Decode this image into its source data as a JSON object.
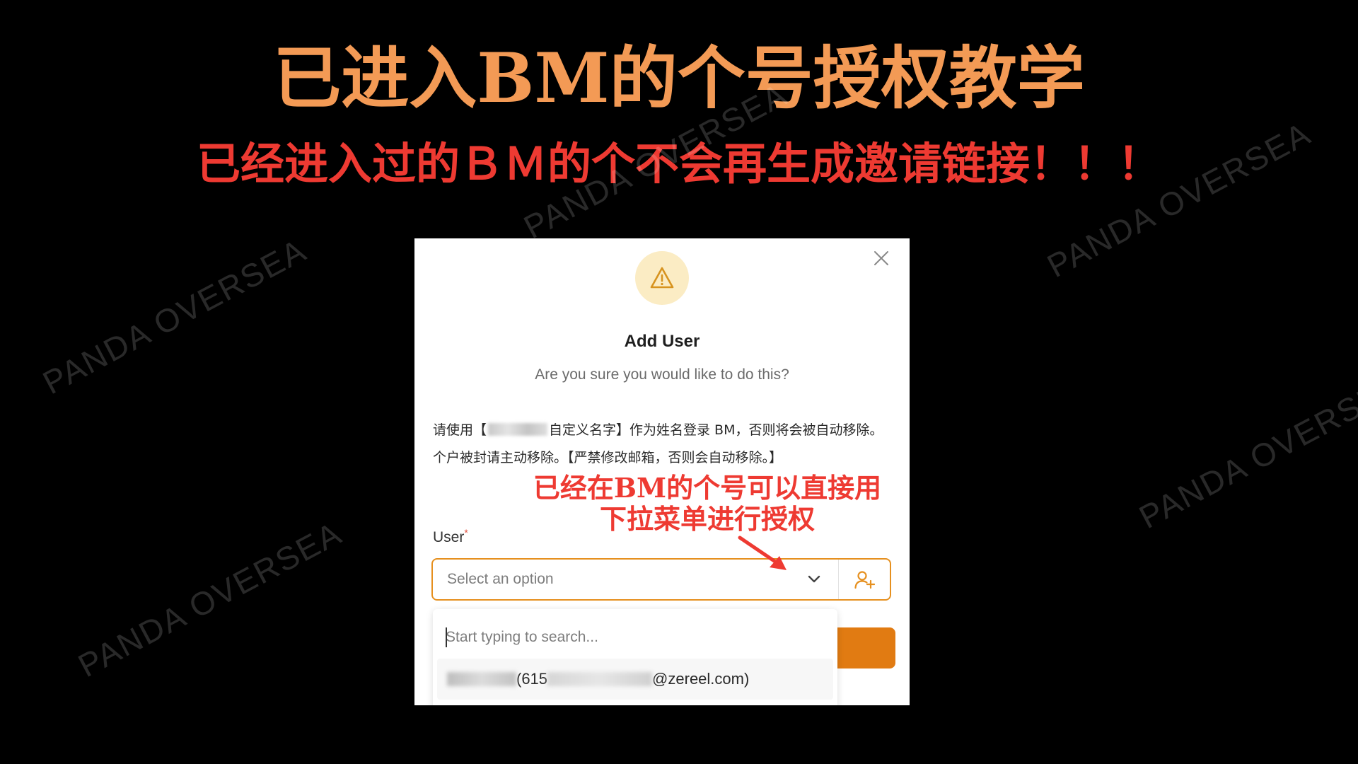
{
  "headline": "已进入BM的个号授权教学",
  "subheadline": "已经进入过的ＢＭ的个不会再生成邀请链接！！！",
  "watermark_text": "PANDA OVERSEA",
  "modal": {
    "title": "Add User",
    "subtitle": "Are you sure you would like to do this?",
    "notice": {
      "part1": "请使用【",
      "part2": "自定义名字】作为姓名登录 BM，否则将会被自动移除。个户被封请主动移除。【严禁修改邮箱，否则会自动移除。】"
    },
    "user_field": {
      "label": "User",
      "required_mark": "*",
      "placeholder": "Select an option"
    },
    "dropdown": {
      "search_placeholder": "Start typing to search...",
      "option": {
        "id_prefix": " (615",
        "email_suffix": "@zereel.com)"
      }
    }
  },
  "annotation": {
    "line1": "已经在BM的个号可以直接用",
    "line2": "下拉菜单进行授权"
  },
  "icons": {
    "warning": "warning-triangle-icon",
    "close": "close-icon",
    "chevron": "chevron-down-icon",
    "add_user": "user-plus-icon"
  },
  "colors": {
    "headline": "#f39a55",
    "subheadline": "#ee3a32",
    "annotation": "#ee3a32",
    "accent": "#e6901f",
    "button": "#e17b12",
    "warning_bg": "#fbecc4"
  }
}
